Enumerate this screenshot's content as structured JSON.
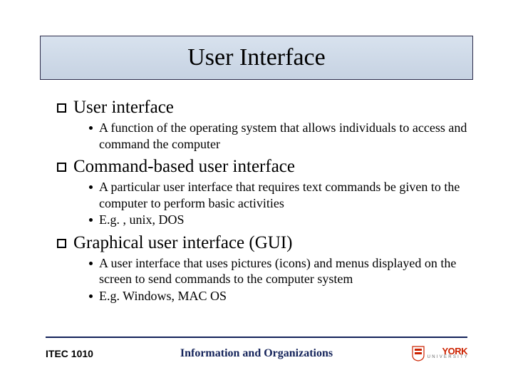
{
  "title": "User Interface",
  "items": [
    {
      "heading": "User interface",
      "subs": [
        "A function of the operating system that allows individuals to access and command the computer"
      ]
    },
    {
      "heading": "Command-based user interface",
      "subs": [
        "A particular user interface that requires text commands be given to the computer to perform basic activities",
        "E.g. , unix, DOS"
      ]
    },
    {
      "heading": "Graphical user interface (GUI)",
      "subs": [
        "A user interface that uses pictures (icons) and menus displayed on the screen to send commands to the computer system",
        "E.g. Windows, MAC OS"
      ]
    }
  ],
  "footer": {
    "course": "ITEC 1010",
    "subtitle": "Information and Organizations",
    "logo": {
      "name": "YORK",
      "sub": "U N I V E R S I T Y"
    }
  }
}
